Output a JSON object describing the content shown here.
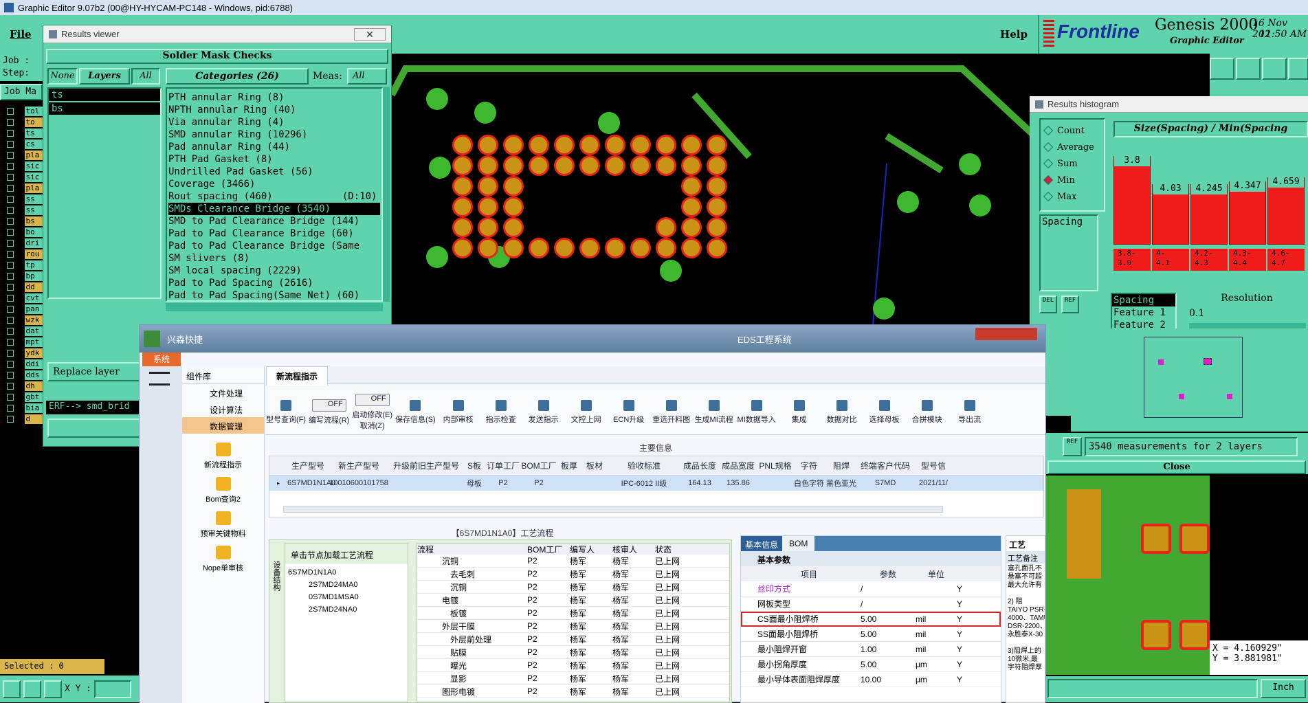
{
  "titlebar": {
    "text": "Graphic Editor 9.07b2 (00@HY-HYCAM-PC148 - Windows, pid:6788)"
  },
  "menu": {
    "file": "File",
    "help": "Help"
  },
  "frontline": {
    "brand": "Frontline",
    "product": "Genesis 2000",
    "subtitle": "Graphic Editor",
    "date": "16 Nov 202",
    "time": "11:50 AM"
  },
  "left": {
    "job_label": "Job :",
    "step_label": "Step:",
    "job_matrix": "Job Ma",
    "layers": [
      "tol",
      "to",
      "ts",
      "cs",
      "pla",
      "sic",
      "sic",
      "pla",
      "ss",
      "ss",
      "bs",
      "bo",
      "dri",
      "rou",
      "tp",
      "bp",
      "dd",
      "cvt",
      "pan",
      "wzk",
      "dat",
      "mpt",
      "ydk",
      "ddi",
      "dds",
      "dh",
      "gbt",
      "bia",
      "d"
    ],
    "selected": "Selected : 0",
    "xy_label": "X Y :"
  },
  "results_viewer": {
    "title": "Results viewer",
    "header": "Solder Mask Checks",
    "btn_none": "None",
    "btn_layers": "Layers",
    "btn_all": "All",
    "categories_label": "Categories (26)",
    "meas_label": "Meas:",
    "meas_value": "All",
    "layer_items": [
      "ts",
      "bs"
    ],
    "categories": [
      "PTH annular Ring (8)",
      "NPTH annular Ring (40)",
      "Via annular Ring (4)",
      "SMD annular Ring (10296)",
      "Pad annular Ring (44)",
      "PTH Pad Gasket (8)",
      "Undrilled Pad Gasket (56)",
      "Coverage (3466)",
      "Rout spacing (460)            (D:10)",
      "SMDs Clearance Bridge (3540)",
      "SMD to Pad Clearance Bridge (144)",
      "Pad to Pad Clearance Bridge (60)",
      "Pad to Pad Clearance Bridge (Same",
      "SM slivers (8)",
      "SM local spacing (2229)",
      "Pad to Pad Spacing (2616)",
      "Pad to Pad Spacing(Same Net) (60)"
    ],
    "selected_index": 9,
    "replace_layer": "Replace layer",
    "erf_text": "ERF--> smd_brid",
    "close_c": "C"
  },
  "histogram": {
    "title": "Results histogram",
    "options": [
      "Count",
      "Average",
      "Sum",
      "Min",
      "Max"
    ],
    "selected_option": "Min",
    "spacing_item": "Spacing",
    "chart_title": "Size(Spacing) / Min(Spacing",
    "bar_values": [
      "3.8",
      "4.03",
      "4.245",
      "4.347",
      "4.659"
    ],
    "ranges": [
      "3.8-\n3.9",
      "4-\n4.1",
      "4.2-\n4.3",
      "4.3-\n4.4",
      "4.6-\n4.7"
    ],
    "bar_heights": [
      0.92,
      0.63,
      0.63,
      0.66,
      0.7
    ],
    "list2": [
      "Spacing",
      "Feature 1",
      "Feature 2"
    ],
    "resolution_label": "Resolution",
    "resolution_value": "0.1",
    "measurements": "3540 measurements for 2 layers",
    "close": "Close",
    "del": "DEL",
    "ref": "REF"
  },
  "right_bottom": {
    "x": "X = 4.160929\"",
    "y": "Y = 3.881981\"",
    "unit": "Inch"
  },
  "eds": {
    "title": "EDS工程系统",
    "app_name": "兴森快捷",
    "system_tab": "系统",
    "sidebar_header": "组件库",
    "sidebar_items": [
      "文件处理",
      "设计算法",
      "数据管理"
    ],
    "module_items": [
      "新流程指示",
      "Bom查询2",
      "预审关键物料",
      "Nope单审核"
    ],
    "tab": "新流程指示",
    "toolbar": [
      "型号查询(F)",
      "编写流程(R)",
      "启动修改(E)\n取消(Z)",
      "保存信息(S)",
      "内部审核",
      "指示检查",
      "发送指示",
      "文控上网",
      "ECN升级",
      "重选开料图",
      "生成MI流程",
      "MI数据导入",
      "集成",
      "数据对比",
      "选择母板",
      "合拼模块",
      "导出流"
    ],
    "toggle_off": "OFF",
    "section_main": "主要信息",
    "columns": [
      "生产型号",
      "新生产型号",
      "升级前旧生产型号",
      "S板",
      "订单工厂",
      "BOM工厂",
      "板厚",
      "板材",
      "验收标准",
      "成品长度",
      "成品宽度",
      "PNL规格",
      "字符",
      "阻焊",
      "终端客户代码",
      "型号信"
    ],
    "row": [
      "6S7MD1N1A0",
      "10010600101758",
      "",
      "母板",
      "P2",
      "P2",
      "",
      "",
      "IPC-6012 II级",
      "164.13",
      "135.86",
      "",
      "白色字符",
      "黑色亚光",
      "S7MD",
      "2021/11/"
    ],
    "process_title": "【6S7MD1N1A0】工艺流程",
    "tree_hint": "单击节点加载工艺流程",
    "side_label": "设备结构",
    "tree_root": "6S7MD1N1A0",
    "tree_children": [
      "2S7MD24MA0",
      "0S7MD1MSA0",
      "2S7MD24NA0"
    ],
    "flow_headers": [
      "流程",
      "BOM工厂",
      "编写人",
      "核审人",
      "状态"
    ],
    "flow_rows": [
      [
        "沉铜",
        "P2",
        "杨军",
        "杨军",
        "已上网"
      ],
      [
        "去毛刺",
        "P2",
        "杨军",
        "杨军",
        "已上网"
      ],
      [
        "沉铜",
        "P2",
        "杨军",
        "杨军",
        "已上网"
      ],
      [
        "电镀",
        "P2",
        "杨军",
        "杨军",
        "已上网"
      ],
      [
        "板镀",
        "P2",
        "杨军",
        "杨军",
        "已上网"
      ],
      [
        "外层干膜",
        "P2",
        "杨军",
        "杨军",
        "已上网"
      ],
      [
        "外层前处理",
        "P2",
        "杨军",
        "杨军",
        "已上网"
      ],
      [
        "贴膜",
        "P2",
        "杨军",
        "杨军",
        "已上网"
      ],
      [
        "曝光",
        "P2",
        "杨军",
        "杨军",
        "已上网"
      ],
      [
        "显影",
        "P2",
        "杨军",
        "杨军",
        "已上网"
      ],
      [
        "图形电镀",
        "P2",
        "杨军",
        "杨军",
        "已上网"
      ]
    ],
    "info_tabs": [
      "基本信息",
      "BOM"
    ],
    "info_sub": "基本参数",
    "param_headers": [
      "项目",
      "参数",
      "单位"
    ],
    "params": [
      [
        "丝印方式",
        "/",
        "",
        "Y"
      ],
      [
        "网板类型",
        "/",
        "",
        "Y"
      ],
      [
        "CS面最小阻焊桥",
        "5.00",
        "mil",
        "Y"
      ],
      [
        "SS面最小阻焊桥",
        "5.00",
        "mil",
        "Y"
      ],
      [
        "最小阻焊开窗",
        "1.00",
        "mil",
        "Y"
      ],
      [
        "最小拐角厚度",
        "5.00",
        "μm",
        "Y"
      ],
      [
        "最小导体表面阻焊厚度",
        "10.00",
        "μm",
        "Y"
      ]
    ],
    "remark_title": "工艺备注",
    "remark_header": "工艺",
    "remark_text": "塞孔面孔不\n悬塞不可超\n最大允许有\n\n2) 阻\nTAIYO PSR-\n4000、TAMU\nDSR-2200、\n永胜泰X-30\n\n3)阻焊上的\n10微米,最\n字符阻焊厚"
  }
}
